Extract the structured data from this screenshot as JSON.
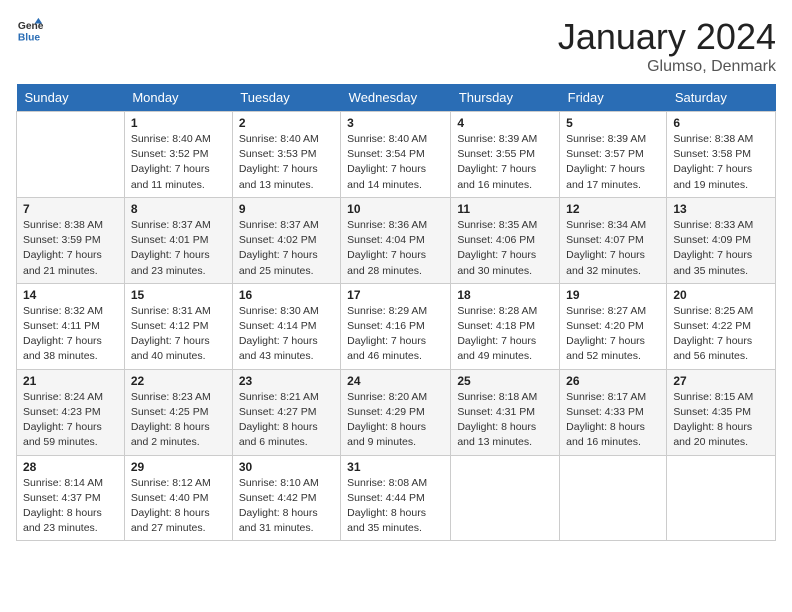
{
  "logo": {
    "text_general": "General",
    "text_blue": "Blue"
  },
  "title": "January 2024",
  "location": "Glumso, Denmark",
  "days_header": [
    "Sunday",
    "Monday",
    "Tuesday",
    "Wednesday",
    "Thursday",
    "Friday",
    "Saturday"
  ],
  "weeks": [
    [
      {
        "day": "",
        "sunrise": "",
        "sunset": "",
        "daylight": ""
      },
      {
        "day": "1",
        "sunrise": "Sunrise: 8:40 AM",
        "sunset": "Sunset: 3:52 PM",
        "daylight": "Daylight: 7 hours and 11 minutes."
      },
      {
        "day": "2",
        "sunrise": "Sunrise: 8:40 AM",
        "sunset": "Sunset: 3:53 PM",
        "daylight": "Daylight: 7 hours and 13 minutes."
      },
      {
        "day": "3",
        "sunrise": "Sunrise: 8:40 AM",
        "sunset": "Sunset: 3:54 PM",
        "daylight": "Daylight: 7 hours and 14 minutes."
      },
      {
        "day": "4",
        "sunrise": "Sunrise: 8:39 AM",
        "sunset": "Sunset: 3:55 PM",
        "daylight": "Daylight: 7 hours and 16 minutes."
      },
      {
        "day": "5",
        "sunrise": "Sunrise: 8:39 AM",
        "sunset": "Sunset: 3:57 PM",
        "daylight": "Daylight: 7 hours and 17 minutes."
      },
      {
        "day": "6",
        "sunrise": "Sunrise: 8:38 AM",
        "sunset": "Sunset: 3:58 PM",
        "daylight": "Daylight: 7 hours and 19 minutes."
      }
    ],
    [
      {
        "day": "7",
        "sunrise": "Sunrise: 8:38 AM",
        "sunset": "Sunset: 3:59 PM",
        "daylight": "Daylight: 7 hours and 21 minutes."
      },
      {
        "day": "8",
        "sunrise": "Sunrise: 8:37 AM",
        "sunset": "Sunset: 4:01 PM",
        "daylight": "Daylight: 7 hours and 23 minutes."
      },
      {
        "day": "9",
        "sunrise": "Sunrise: 8:37 AM",
        "sunset": "Sunset: 4:02 PM",
        "daylight": "Daylight: 7 hours and 25 minutes."
      },
      {
        "day": "10",
        "sunrise": "Sunrise: 8:36 AM",
        "sunset": "Sunset: 4:04 PM",
        "daylight": "Daylight: 7 hours and 28 minutes."
      },
      {
        "day": "11",
        "sunrise": "Sunrise: 8:35 AM",
        "sunset": "Sunset: 4:06 PM",
        "daylight": "Daylight: 7 hours and 30 minutes."
      },
      {
        "day": "12",
        "sunrise": "Sunrise: 8:34 AM",
        "sunset": "Sunset: 4:07 PM",
        "daylight": "Daylight: 7 hours and 32 minutes."
      },
      {
        "day": "13",
        "sunrise": "Sunrise: 8:33 AM",
        "sunset": "Sunset: 4:09 PM",
        "daylight": "Daylight: 7 hours and 35 minutes."
      }
    ],
    [
      {
        "day": "14",
        "sunrise": "Sunrise: 8:32 AM",
        "sunset": "Sunset: 4:11 PM",
        "daylight": "Daylight: 7 hours and 38 minutes."
      },
      {
        "day": "15",
        "sunrise": "Sunrise: 8:31 AM",
        "sunset": "Sunset: 4:12 PM",
        "daylight": "Daylight: 7 hours and 40 minutes."
      },
      {
        "day": "16",
        "sunrise": "Sunrise: 8:30 AM",
        "sunset": "Sunset: 4:14 PM",
        "daylight": "Daylight: 7 hours and 43 minutes."
      },
      {
        "day": "17",
        "sunrise": "Sunrise: 8:29 AM",
        "sunset": "Sunset: 4:16 PM",
        "daylight": "Daylight: 7 hours and 46 minutes."
      },
      {
        "day": "18",
        "sunrise": "Sunrise: 8:28 AM",
        "sunset": "Sunset: 4:18 PM",
        "daylight": "Daylight: 7 hours and 49 minutes."
      },
      {
        "day": "19",
        "sunrise": "Sunrise: 8:27 AM",
        "sunset": "Sunset: 4:20 PM",
        "daylight": "Daylight: 7 hours and 52 minutes."
      },
      {
        "day": "20",
        "sunrise": "Sunrise: 8:25 AM",
        "sunset": "Sunset: 4:22 PM",
        "daylight": "Daylight: 7 hours and 56 minutes."
      }
    ],
    [
      {
        "day": "21",
        "sunrise": "Sunrise: 8:24 AM",
        "sunset": "Sunset: 4:23 PM",
        "daylight": "Daylight: 7 hours and 59 minutes."
      },
      {
        "day": "22",
        "sunrise": "Sunrise: 8:23 AM",
        "sunset": "Sunset: 4:25 PM",
        "daylight": "Daylight: 8 hours and 2 minutes."
      },
      {
        "day": "23",
        "sunrise": "Sunrise: 8:21 AM",
        "sunset": "Sunset: 4:27 PM",
        "daylight": "Daylight: 8 hours and 6 minutes."
      },
      {
        "day": "24",
        "sunrise": "Sunrise: 8:20 AM",
        "sunset": "Sunset: 4:29 PM",
        "daylight": "Daylight: 8 hours and 9 minutes."
      },
      {
        "day": "25",
        "sunrise": "Sunrise: 8:18 AM",
        "sunset": "Sunset: 4:31 PM",
        "daylight": "Daylight: 8 hours and 13 minutes."
      },
      {
        "day": "26",
        "sunrise": "Sunrise: 8:17 AM",
        "sunset": "Sunset: 4:33 PM",
        "daylight": "Daylight: 8 hours and 16 minutes."
      },
      {
        "day": "27",
        "sunrise": "Sunrise: 8:15 AM",
        "sunset": "Sunset: 4:35 PM",
        "daylight": "Daylight: 8 hours and 20 minutes."
      }
    ],
    [
      {
        "day": "28",
        "sunrise": "Sunrise: 8:14 AM",
        "sunset": "Sunset: 4:37 PM",
        "daylight": "Daylight: 8 hours and 23 minutes."
      },
      {
        "day": "29",
        "sunrise": "Sunrise: 8:12 AM",
        "sunset": "Sunset: 4:40 PM",
        "daylight": "Daylight: 8 hours and 27 minutes."
      },
      {
        "day": "30",
        "sunrise": "Sunrise: 8:10 AM",
        "sunset": "Sunset: 4:42 PM",
        "daylight": "Daylight: 8 hours and 31 minutes."
      },
      {
        "day": "31",
        "sunrise": "Sunrise: 8:08 AM",
        "sunset": "Sunset: 4:44 PM",
        "daylight": "Daylight: 8 hours and 35 minutes."
      },
      {
        "day": "",
        "sunrise": "",
        "sunset": "",
        "daylight": ""
      },
      {
        "day": "",
        "sunrise": "",
        "sunset": "",
        "daylight": ""
      },
      {
        "day": "",
        "sunrise": "",
        "sunset": "",
        "daylight": ""
      }
    ]
  ]
}
